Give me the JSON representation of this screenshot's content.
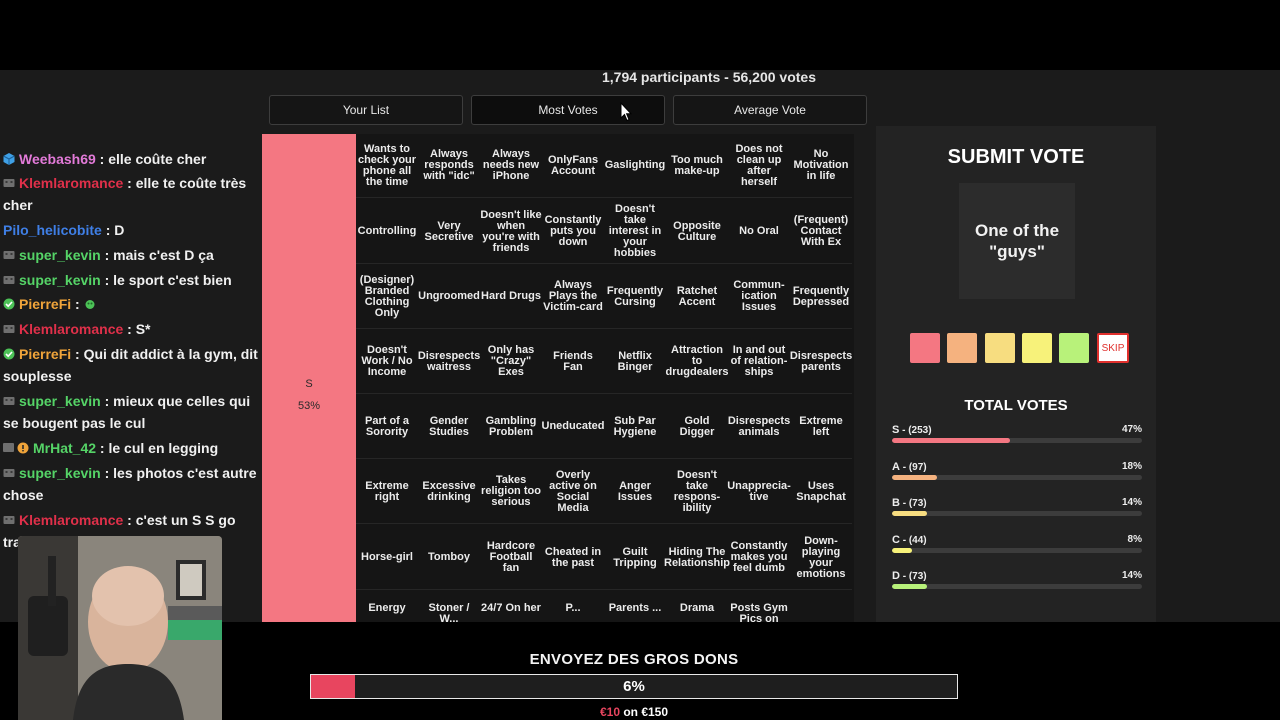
{
  "header": {
    "participants": "1,794 participants - 56,200 votes",
    "tabs": [
      {
        "label": "Your List",
        "active": false
      },
      {
        "label": "Most Votes",
        "active": true
      },
      {
        "label": "Average Vote",
        "active": false
      }
    ]
  },
  "tier": {
    "letter": "S",
    "percent": "53%",
    "color": "#f47782"
  },
  "grid": [
    [
      "Wants to check your phone all the time",
      "Always responds with \"idc\"",
      "Always needs new iPhone",
      "OnlyFans Account",
      "Gaslighting",
      "Too much make-up",
      "Does not clean up after herself",
      "No Motivation in life"
    ],
    [
      "Controlling",
      "Very Secretive",
      "Doesn't like when you're with friends",
      "Constantly puts you down",
      "Doesn't take interest in your hobbies",
      "Opposite Culture",
      "No Oral",
      "(Frequent) Contact With Ex"
    ],
    [
      "(Designer) Branded Clothing Only",
      "Ungroomed",
      "Hard Drugs",
      "Always Plays the Victim-card",
      "Frequently Cursing",
      "Ratchet Accent",
      "Commun-ication Issues",
      "Frequently Depressed"
    ],
    [
      "Doesn't Work / No Income",
      "Disrespects waitress",
      "Only has \"Crazy\" Exes",
      "Friends Fan",
      "Netflix Binger",
      "Attraction to drugdealers",
      "In and out of relation-ships",
      "Disrespects parents"
    ],
    [
      "Part of a Sorority",
      "Gender Studies",
      "Gambling Problem",
      "Uneducated",
      "Sub Par Hygiene",
      "Gold Digger",
      "Disrespects animals",
      "Extreme left"
    ],
    [
      "Extreme right",
      "Excessive drinking",
      "Takes religion too serious",
      "Overly active on Social Media",
      "Anger Issues",
      "Doesn't take respons-ibility",
      "Unapprecia-tive",
      "Uses Snapchat"
    ],
    [
      "Horse-girl",
      "Tomboy",
      "Hardcore Football fan",
      "Cheated in the past",
      "Guilt Tripping",
      "Hiding The Relationship",
      "Constantly makes you feel dumb",
      "Down-playing your emotions"
    ],
    [
      "Energy",
      "Stoner / W...",
      "24/7 On her",
      "P...",
      "Parents ...",
      "Drama",
      "Posts Gym Pics on",
      ""
    ]
  ],
  "vote_panel": {
    "title": "SUBMIT VOTE",
    "current_item": "One of the \"guys\"",
    "skip_label": "SKIP",
    "tier_colors": [
      "#f47782",
      "#f5b27f",
      "#f7dd80",
      "#f7f27a",
      "#b8f27a"
    ],
    "total_title": "TOTAL VOTES",
    "totals": [
      {
        "tier": "S",
        "count": " - (253)",
        "percent": "47%",
        "value": 0.47,
        "color": "#f47782"
      },
      {
        "tier": "A",
        "count": " - (97)",
        "percent": "18%",
        "value": 0.18,
        "color": "#f5b27f"
      },
      {
        "tier": "B",
        "count": " - (73)",
        "percent": "14%",
        "value": 0.14,
        "color": "#f7dd80"
      },
      {
        "tier": "C",
        "count": " - (44)",
        "percent": "8%",
        "value": 0.08,
        "color": "#f7f27a"
      },
      {
        "tier": "D",
        "count": " - (73)",
        "percent": "14%",
        "value": 0.14,
        "color": "#b8f27a"
      }
    ]
  },
  "chat": [
    {
      "badge": "cube-icon",
      "user": "Weebash69",
      "color": "#e27ad8",
      "text": " : elle coûte cher"
    },
    {
      "badge": "robot-icon",
      "user": "Klemlaromance",
      "color": "#e0304a",
      "text": " : elle te coûte très cher"
    },
    {
      "badge": "",
      "user": "Pilo_helicobite",
      "color": "#3f7fe6",
      "text": " : D"
    },
    {
      "badge": "robot-icon",
      "user": "super_kevin",
      "color": "#55d467",
      "text": " : mais c'est D ça"
    },
    {
      "badge": "robot-icon",
      "user": "super_kevin",
      "color": "#55d467",
      "text": " : le sport c'est bien"
    },
    {
      "badge": "check-icon",
      "user": "PierreFi",
      "color": "#f0a43a",
      "text": " : "
    },
    {
      "badge": "robot-icon",
      "user": "Klemlaromance",
      "color": "#e0304a",
      "text": " : S*"
    },
    {
      "badge": "check-icon",
      "user": "PierreFi",
      "color": "#f0a43a",
      "text": " : Qui dit addict à la gym, dit souplesse"
    },
    {
      "badge": "robot-icon",
      "user": "super_kevin",
      "color": "#55d467",
      "text": " : mieux que celles qui se bougent pas le cul"
    },
    {
      "badge": "badges-icon",
      "user": "MrHat_42",
      "color": "#55d467",
      "text": " : le cul en legging"
    },
    {
      "badge": "robot-icon",
      "user": "super_kevin",
      "color": "#55d467",
      "text": " : les photos c'est autre chose"
    },
    {
      "badge": "robot-icon",
      "user": "Klemlaromance",
      "color": "#e0304a",
      "text": " : c'est un S S go train"
    }
  ],
  "donation": {
    "title": "ENVOYEZ DES GROS DONS",
    "percent_label": "6%",
    "progress": 0.068,
    "raised": "€10",
    "goal_text": " on €150"
  }
}
